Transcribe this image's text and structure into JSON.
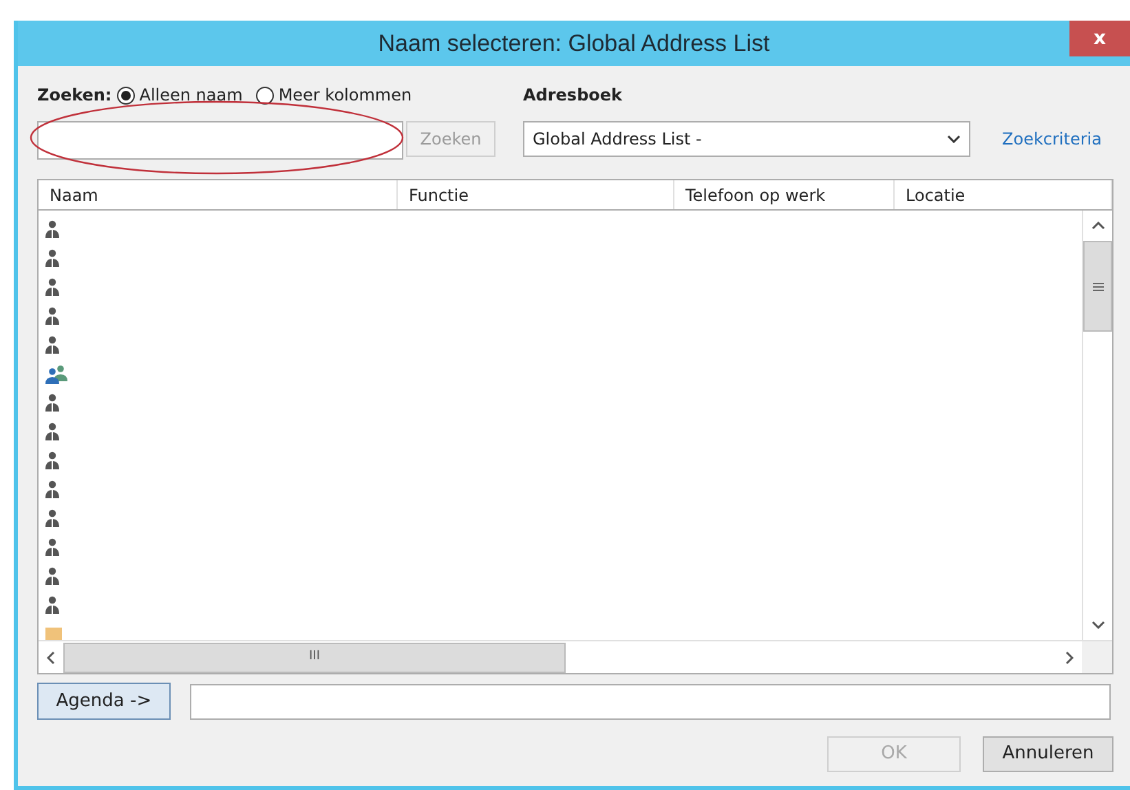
{
  "window": {
    "title": "Naam selecteren: Global Address List",
    "close": "x"
  },
  "search": {
    "label": "Zoeken:",
    "options": [
      {
        "label": "Alleen naam",
        "selected": true
      },
      {
        "label": "Meer kolommen",
        "selected": false
      }
    ],
    "button": "Zoeken"
  },
  "address_book": {
    "label": "Adresboek",
    "value": "Global Address List -",
    "link": "Zoekcriteria"
  },
  "table": {
    "columns": [
      "Naam",
      "Functie",
      "Telefoon op werk",
      "Locatie"
    ],
    "rows": [
      {
        "kind": "user"
      },
      {
        "kind": "user"
      },
      {
        "kind": "user"
      },
      {
        "kind": "user"
      },
      {
        "kind": "user"
      },
      {
        "kind": "group"
      },
      {
        "kind": "user"
      },
      {
        "kind": "user"
      },
      {
        "kind": "user"
      },
      {
        "kind": "user"
      },
      {
        "kind": "user"
      },
      {
        "kind": "user"
      },
      {
        "kind": "user"
      },
      {
        "kind": "user"
      },
      {
        "kind": "folder"
      }
    ],
    "hscroll_grip": "III"
  },
  "agenda_button": "Agenda ->",
  "buttons": [
    {
      "label": "OK",
      "disabled": true
    },
    {
      "label": "Annuleren",
      "disabled": false
    }
  ]
}
